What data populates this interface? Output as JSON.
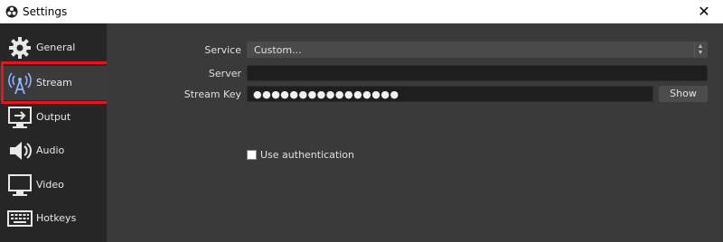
{
  "window": {
    "title": "Settings",
    "close_label": "✕"
  },
  "sidebar": {
    "items": [
      {
        "label": "General",
        "icon": "gear-icon"
      },
      {
        "label": "Stream",
        "icon": "broadcast-tower-icon",
        "selected": true,
        "highlighted": true
      },
      {
        "label": "Output",
        "icon": "output-monitor-icon"
      },
      {
        "label": "Audio",
        "icon": "speaker-icon"
      },
      {
        "label": "Video",
        "icon": "monitor-icon"
      },
      {
        "label": "Hotkeys",
        "icon": "keyboard-icon"
      }
    ]
  },
  "stream": {
    "service_label": "Service",
    "service_value": "Custom...",
    "server_label": "Server",
    "server_value": "",
    "stream_key_label": "Stream Key",
    "stream_key_value": "●●●●●●●●●●●●●●●●",
    "show_button": "Show",
    "use_auth_label": "Use authentication",
    "use_auth_checked": false
  },
  "colors": {
    "highlight_border": "#e8131f",
    "sidebar_bg": "#262626",
    "panel_bg": "#3a3a3a"
  }
}
